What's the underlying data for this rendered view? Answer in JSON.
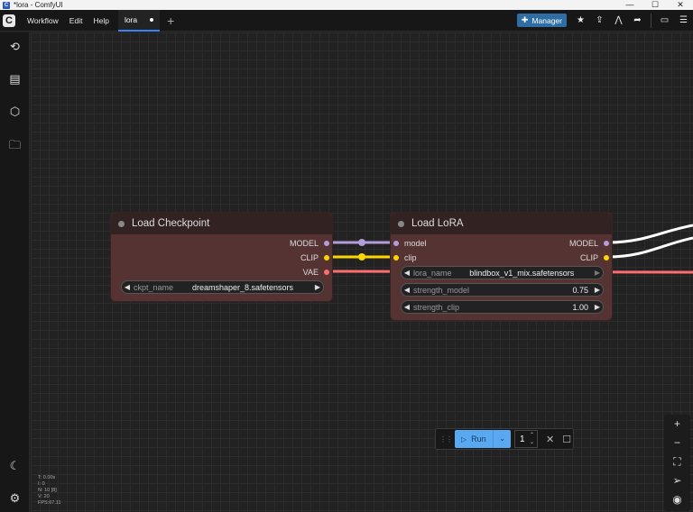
{
  "window": {
    "title": "*lora - ComfyUI",
    "controls": [
      "—",
      "☐",
      "✕"
    ]
  },
  "menubar": {
    "logo": "C",
    "items": [
      "Workflow",
      "Edit",
      "Help"
    ],
    "tab": {
      "label": "lora"
    },
    "add_tab": "+",
    "manager_label": "Manager"
  },
  "nodes": {
    "checkpoint": {
      "title": "Load Checkpoint",
      "outputs": [
        "MODEL",
        "CLIP",
        "VAE"
      ],
      "ckpt_label": "ckpt_name",
      "ckpt_value": "dreamshaper_8.safetensors"
    },
    "lora": {
      "title": "Load LoRA",
      "inputs": [
        "model",
        "clip"
      ],
      "outputs": [
        "MODEL",
        "CLIP"
      ],
      "lora_label": "lora_name",
      "lora_value": "blindbox_v1_mix.safetensors",
      "strength_model_label": "strength_model",
      "strength_model_value": "0.75",
      "strength_clip_label": "strength_clip",
      "strength_clip_value": "1.00"
    }
  },
  "runbar": {
    "run_label": "Run",
    "count": "1"
  },
  "stats": [
    "T: 0.00s",
    "I: 0",
    "N: 10 [8]",
    "V: 20",
    "FPS:67.11"
  ],
  "colors": {
    "model": "#b39ddb",
    "clip": "#ffd500",
    "vae": "#ff6e6e",
    "accent": "#5aa9f0",
    "node_body": "#553333",
    "node_header": "#332222"
  }
}
